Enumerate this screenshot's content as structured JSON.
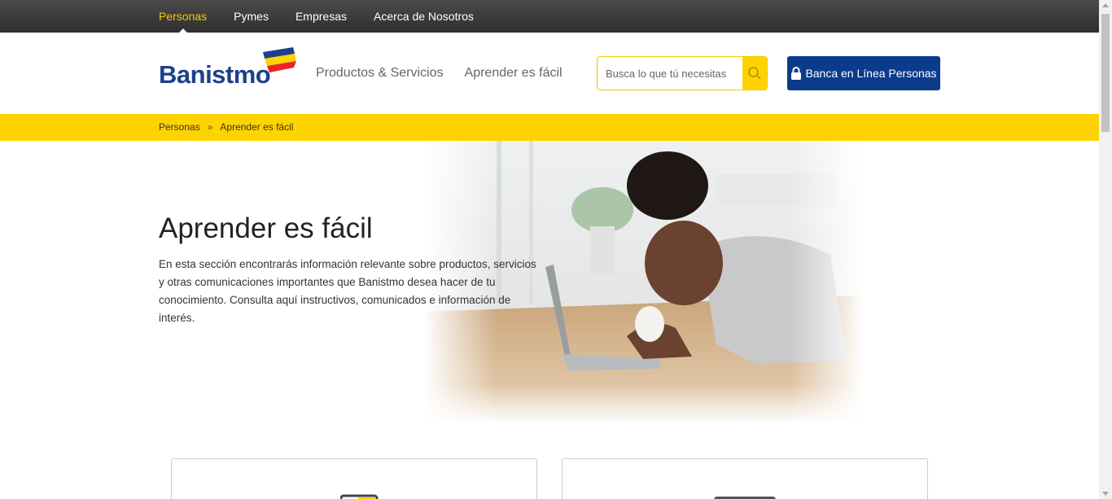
{
  "topnav": {
    "items": [
      {
        "label": "Personas",
        "active": true
      },
      {
        "label": "Pymes"
      },
      {
        "label": "Empresas"
      },
      {
        "label": "Acerca de Nosotros"
      }
    ]
  },
  "header": {
    "logo_text": "Banistmo",
    "nav": [
      "Productos & Servicios",
      "Aprender es fácil"
    ],
    "search": {
      "placeholder": "Busca lo que tú necesitas",
      "icon": "search-icon"
    },
    "online_button": {
      "label": "Banca en Línea Personas",
      "icon": "lock-icon"
    }
  },
  "breadcrumb": {
    "items": [
      "Personas",
      "Aprender es fácil"
    ],
    "separator": "»"
  },
  "hero": {
    "title": "Aprender es fácil",
    "text": "En esta sección encontrarás información relevante sobre productos, servicios y otras comunicaciones importantes que Banistmo desea hacer de tu conocimiento. Consulta aquí instructivos, comunicados e información de interés."
  },
  "colors": {
    "brand_blue": "#0b3c8c",
    "brand_yellow": "#ffd300",
    "topbar": "#3a3a3a",
    "active_tab": "#f7c600"
  }
}
